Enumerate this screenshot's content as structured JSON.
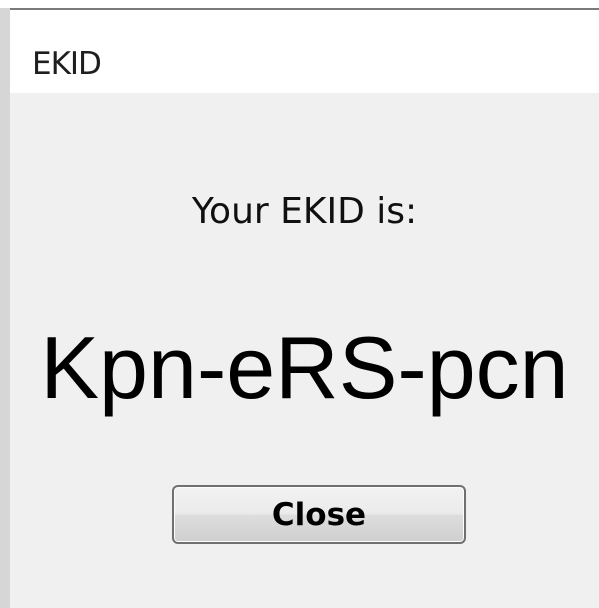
{
  "window": {
    "title": "EKID"
  },
  "dialog": {
    "prompt": "Your EKID is:",
    "ekid": "Kpn-eRS-pcn",
    "close_label": "Close"
  },
  "colors": {
    "content_background": "#f0f0f0",
    "titlebar_background": "#ffffff",
    "frame": "#d6d6d6",
    "text": "#000000"
  }
}
